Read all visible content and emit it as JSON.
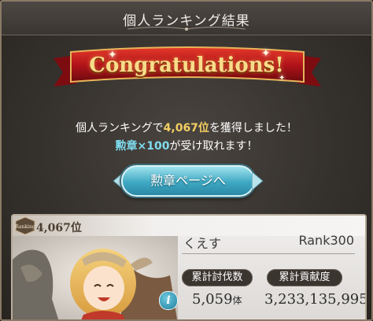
{
  "window": {
    "title": "個人ランキング結果"
  },
  "banner": {
    "text": "Congratulations!"
  },
  "message": {
    "line1_prefix": "個人ランキングで",
    "rank": "4,067位",
    "line1_suffix": "を獲得しました！",
    "reward": "勲章×100",
    "line2_suffix": "が受け取れます！"
  },
  "medal_button": {
    "label": "勲章ページへ"
  },
  "card": {
    "badge_text": "Ranking",
    "rank": "4,067位",
    "player_name": "くえす",
    "rank_level": "Rank300",
    "stats": {
      "kills_label": "累計討伐数",
      "contribution_label": "累計貢献度",
      "kills_value": "5,059",
      "kills_unit": "体",
      "contribution_value": "3,233,135,995"
    }
  },
  "colors": {
    "gold": "#f3cf63",
    "cyan": "#7fdcef",
    "ribbon": "#b3141a"
  },
  "icons": [
    "ranking-badge-icon",
    "info-icon",
    "sparkle-icon"
  ]
}
